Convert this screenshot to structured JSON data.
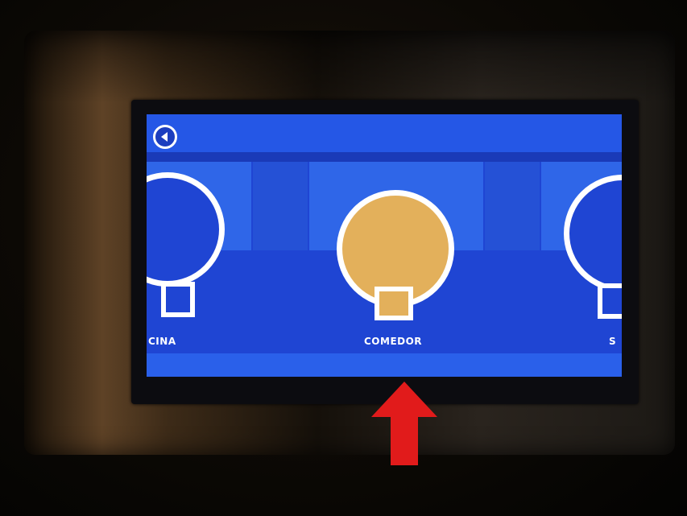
{
  "header": {
    "back_icon": "chevron-left-icon"
  },
  "lights": [
    {
      "label": "CINA",
      "state": "off",
      "color": "#1f45d3"
    },
    {
      "label": "COMEDOR",
      "state": "on",
      "color": "#e3b05b"
    },
    {
      "label": "S",
      "state": "off",
      "color": "#1f45d3"
    }
  ],
  "colors": {
    "screen_bg": "#1f45d3",
    "topbar": "#2557e6",
    "bulb_on": "#e3b05b",
    "outline": "#ffffff",
    "arrow": "#e11b1b"
  }
}
